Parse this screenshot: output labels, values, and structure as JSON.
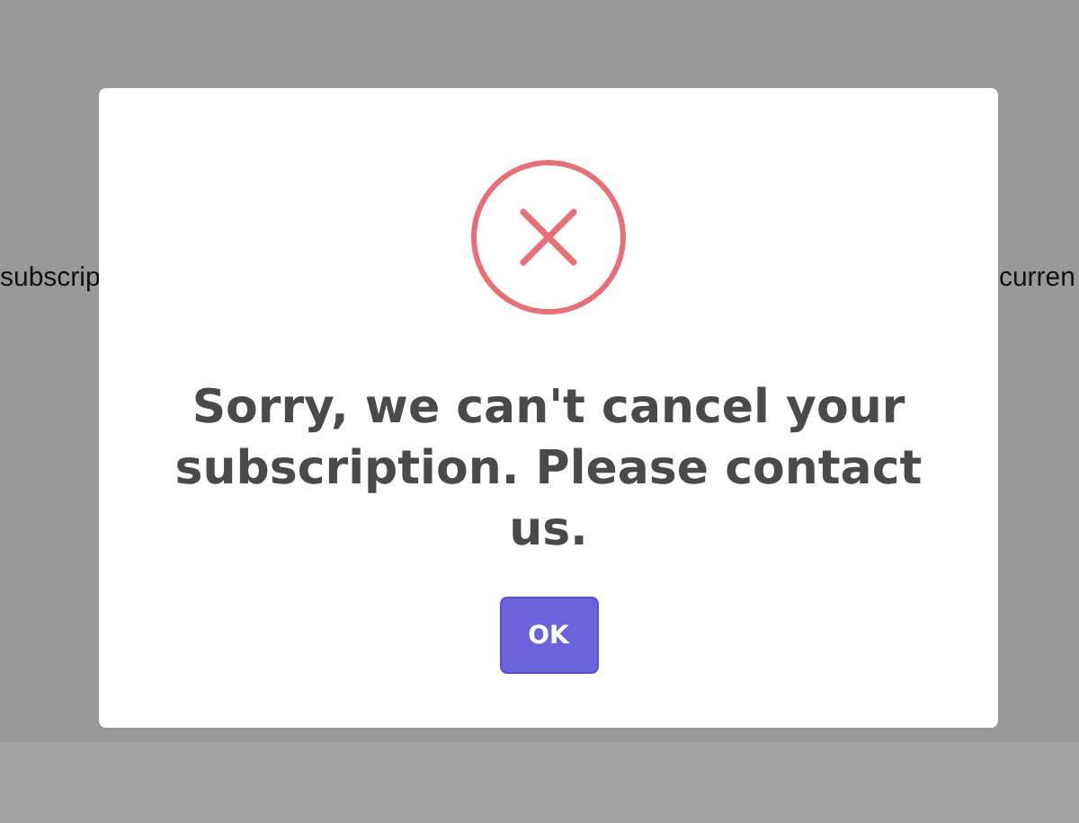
{
  "background": {
    "left_text": "subscrip",
    "right_text": "curren"
  },
  "dialog": {
    "kind": "error",
    "message": "Sorry, we can't cancel your subscription. Please contact us.",
    "button": "OK"
  }
}
